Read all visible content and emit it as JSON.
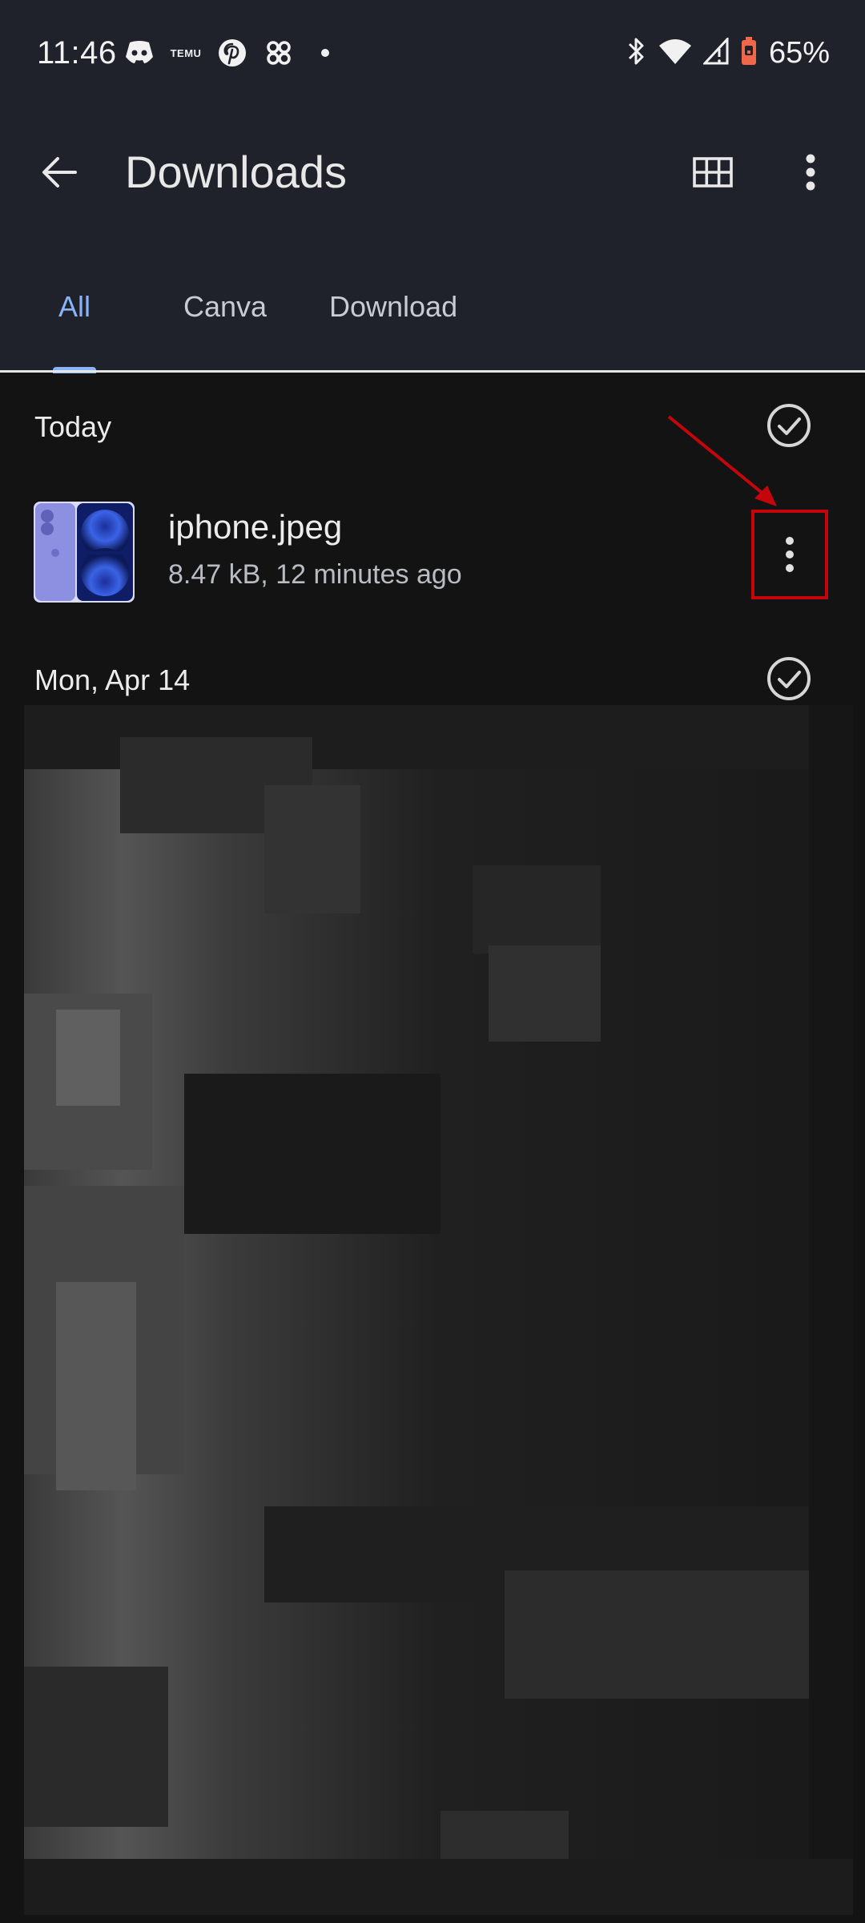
{
  "status_bar": {
    "time": "11:46",
    "temu_label": "TEMU",
    "battery_percent": "65%",
    "icons": [
      "discord-icon",
      "temu-icon",
      "pinterest-icon",
      "threads-icon",
      "notification-dot",
      "bluetooth-icon",
      "wifi-icon",
      "signal-icon",
      "battery-icon"
    ]
  },
  "app_bar": {
    "title": "Downloads",
    "icons": [
      "back-arrow-icon",
      "grid-view-icon",
      "more-vert-icon"
    ]
  },
  "tabs": [
    {
      "label": "All",
      "active": true
    },
    {
      "label": "Canva",
      "active": false
    },
    {
      "label": "Download",
      "active": false
    }
  ],
  "sections": [
    {
      "title": "Today",
      "items": [
        {
          "name": "iphone.jpeg",
          "meta": "8.47 kB, 12 minutes ago"
        }
      ]
    },
    {
      "title": "Mon, Apr 14",
      "items": []
    }
  ],
  "colors": {
    "accent": "#8ab4f8",
    "annotation": "#c4060c",
    "background": "#131313",
    "header": "#1f222a"
  }
}
